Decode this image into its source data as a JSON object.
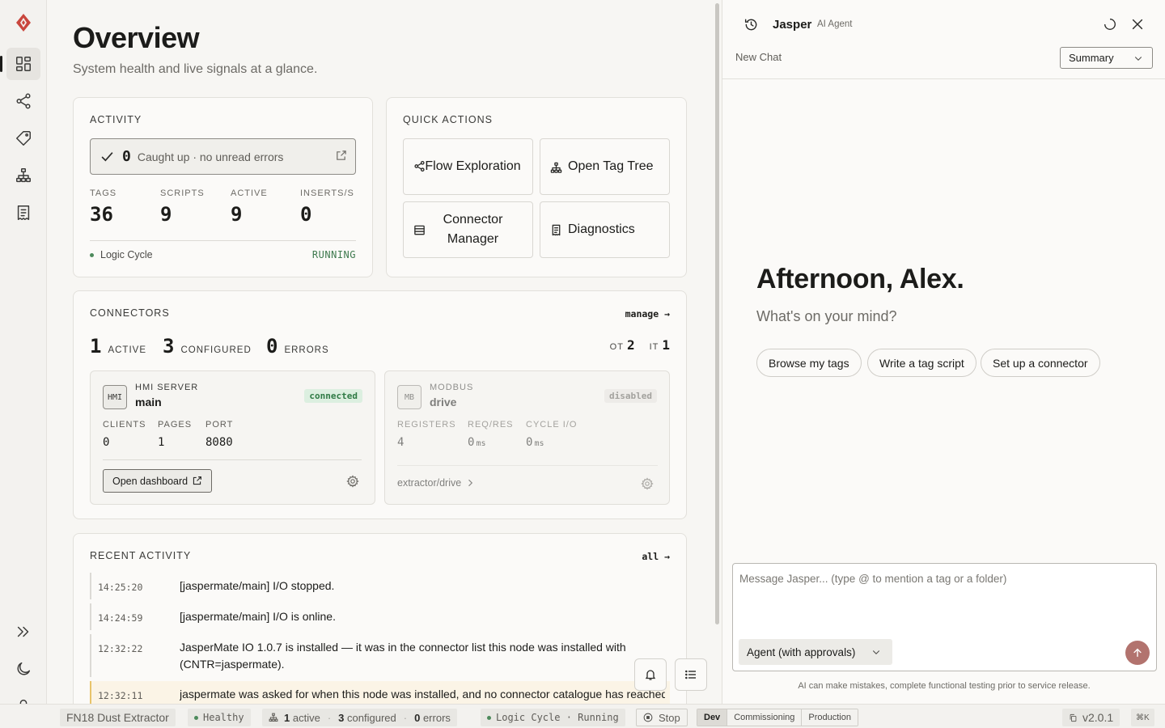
{
  "nav": {
    "items": [
      {
        "name": "overview",
        "icon": "dashboard-grid-icon",
        "active": true
      },
      {
        "name": "flows",
        "icon": "share-nodes-icon"
      },
      {
        "name": "tags",
        "icon": "tag-icon"
      },
      {
        "name": "hierarchy",
        "icon": "hierarchy-icon"
      },
      {
        "name": "logs",
        "icon": "receipt-icon"
      }
    ],
    "bottom": [
      "expand-icon",
      "moon-icon",
      "user-icon"
    ]
  },
  "page": {
    "title": "Overview",
    "subtitle": "System health and live signals at a glance."
  },
  "activity": {
    "title": "ACTIVITY",
    "unread_count": "0",
    "unread_text": "Caught up · no unread errors",
    "stats": [
      {
        "label": "TAGS",
        "value": "36"
      },
      {
        "label": "SCRIPTS",
        "value": "9"
      },
      {
        "label": "ACTIVE",
        "value": "9"
      },
      {
        "label": "INSERTS/S",
        "value": "0"
      }
    ],
    "cycle_label": "Logic Cycle",
    "cycle_state": "RUNNING"
  },
  "quick_actions": {
    "title": "QUICK ACTIONS",
    "items": [
      {
        "label": "Flow Exploration",
        "icon": "share-nodes-icon"
      },
      {
        "label": "Open Tag Tree",
        "icon": "hierarchy-icon"
      },
      {
        "label": "Connector Manager",
        "icon": "server-icon"
      },
      {
        "label": "Diagnostics",
        "icon": "receipt-icon"
      }
    ]
  },
  "connectors": {
    "title": "CONNECTORS",
    "manage": "manage →",
    "counts": [
      {
        "value": "1",
        "label": "ACTIVE"
      },
      {
        "value": "3",
        "label": "CONFIGURED"
      },
      {
        "value": "0",
        "label": "ERRORS"
      }
    ],
    "ot_label": "OT",
    "ot_value": "2",
    "it_label": "IT",
    "it_value": "1",
    "hmi": {
      "badge": "HMI",
      "kind": "HMI SERVER",
      "name": "main",
      "status": "connected",
      "status_color": "#2f7a45",
      "stats": [
        {
          "label": "CLIENTS",
          "value": "0"
        },
        {
          "label": "PAGES",
          "value": "1"
        },
        {
          "label": "PORT",
          "value": "8080"
        }
      ],
      "open_label": "Open dashboard"
    },
    "modbus": {
      "badge": "MB",
      "kind": "MODBUS",
      "name": "drive",
      "status": "disabled",
      "stats": [
        {
          "label": "REGISTERS",
          "value": "4",
          "unit": ""
        },
        {
          "label": "REQ/RES",
          "value": "0",
          "unit": "ms"
        },
        {
          "label": "CYCLE I/O",
          "value": "0",
          "unit": "ms"
        }
      ],
      "path": "extractor/drive"
    }
  },
  "recent": {
    "title": "RECENT ACTIVITY",
    "all": "all →",
    "rows": [
      {
        "time": "14:25:20",
        "msg": "[jaspermate/main] I/O stopped."
      },
      {
        "time": "14:24:59",
        "msg": "[jaspermate/main] I/O is online."
      },
      {
        "time": "12:32:22",
        "msg": "JasperMate IO 1.0.7 is installed — it was in the connector list this node was installed with (CNTR=jaspermate)."
      },
      {
        "time": "12:32:11",
        "msg": "jaspermate was asked for when this node was installed, and no connector catalogue has reached"
      }
    ]
  },
  "assistant": {
    "name": "Jasper",
    "tag": "AI Agent",
    "new_chat": "New Chat",
    "mode": "Summary",
    "greeting": "Afternoon, Alex.",
    "prompt": "What's on your mind?",
    "suggestions": [
      "Browse my tags",
      "Write a tag script",
      "Set up a connector"
    ],
    "placeholder": "Message Jasper... (type @ to mention a tag or a folder)",
    "agent_mode": "Agent (with approvals)",
    "disclaimer": "AI can make mistakes, complete functional testing prior to service release.",
    "send_color": "#b2736e"
  },
  "statusbar": {
    "device": "FN18 Dust Extractor",
    "health": "Healthy",
    "active_n": "1",
    "active_l": "active",
    "configured_n": "3",
    "configured_l": "configured",
    "errors_n": "0",
    "errors_l": "errors",
    "cycle": "Logic Cycle · Running",
    "stop": "Stop",
    "envs": [
      "Dev",
      "Commissioning",
      "Production"
    ],
    "env_selected": "Dev",
    "version": "v2.0.1",
    "shortcut": "⌘K"
  },
  "colors": {
    "brand": "#c9463d",
    "ok": "#4d8a5c",
    "connected_bg": "#dcefe0"
  }
}
